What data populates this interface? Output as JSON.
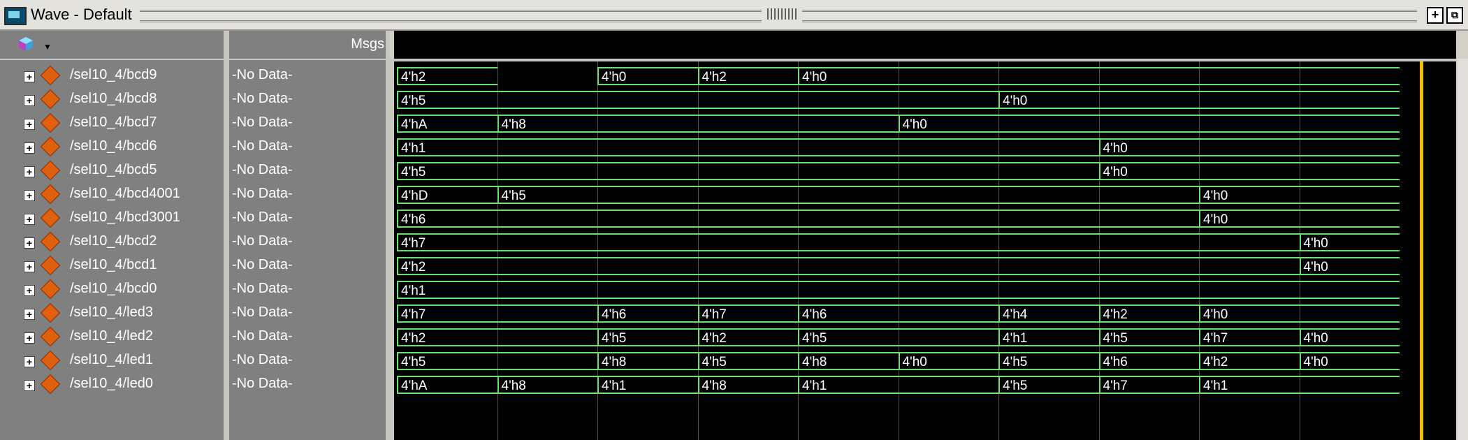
{
  "window": {
    "title": "Wave - Default"
  },
  "header": {
    "msgs_label": "Msgs"
  },
  "signals": [
    {
      "name": "/sel10_4/bcd9",
      "value": "-No Data-",
      "segments": [
        [
          "4'h2",
          0,
          1
        ],
        [
          "4'h0",
          2,
          3
        ],
        [
          "4'h2",
          3,
          4
        ],
        [
          "4'h0",
          4,
          10
        ]
      ]
    },
    {
      "name": "/sel10_4/bcd8",
      "value": "-No Data-",
      "segments": [
        [
          "4'h5",
          0,
          6
        ],
        [
          "4'h0",
          6,
          10
        ]
      ]
    },
    {
      "name": "/sel10_4/bcd7",
      "value": "-No Data-",
      "segments": [
        [
          "4'hA",
          0,
          1
        ],
        [
          "4'h8",
          1,
          5
        ],
        [
          "4'h0",
          5,
          10
        ]
      ]
    },
    {
      "name": "/sel10_4/bcd6",
      "value": "-No Data-",
      "segments": [
        [
          "4'h1",
          0,
          7
        ],
        [
          "4'h0",
          7,
          10
        ]
      ]
    },
    {
      "name": "/sel10_4/bcd5",
      "value": "-No Data-",
      "segments": [
        [
          "4'h5",
          0,
          7
        ],
        [
          "4'h0",
          7,
          10
        ]
      ]
    },
    {
      "name": "/sel10_4/bcd4001",
      "value": "-No Data-",
      "segments": [
        [
          "4'hD",
          0,
          1
        ],
        [
          "4'h5",
          1,
          8
        ],
        [
          "4'h0",
          8,
          10
        ]
      ]
    },
    {
      "name": "/sel10_4/bcd3001",
      "value": "-No Data-",
      "segments": [
        [
          "4'h6",
          0,
          8
        ],
        [
          "4'h0",
          8,
          10
        ]
      ]
    },
    {
      "name": "/sel10_4/bcd2",
      "value": "-No Data-",
      "segments": [
        [
          "4'h7",
          0,
          9
        ],
        [
          "4'h0",
          9,
          10
        ]
      ]
    },
    {
      "name": "/sel10_4/bcd1",
      "value": "-No Data-",
      "segments": [
        [
          "4'h2",
          0,
          9
        ],
        [
          "4'h0",
          9,
          10
        ]
      ]
    },
    {
      "name": "/sel10_4/bcd0",
      "value": "-No Data-",
      "segments": [
        [
          "4'h1",
          0,
          10
        ]
      ]
    },
    {
      "name": "/sel10_4/led3",
      "value": "-No Data-",
      "segments": [
        [
          "4'h7",
          0,
          2
        ],
        [
          "4'h6",
          2,
          3
        ],
        [
          "4'h7",
          3,
          4
        ],
        [
          "4'h6",
          4,
          6
        ],
        [
          "4'h4",
          6,
          7
        ],
        [
          "4'h2",
          7,
          8
        ],
        [
          "4'h0",
          8,
          10
        ]
      ]
    },
    {
      "name": "/sel10_4/led2",
      "value": "-No Data-",
      "segments": [
        [
          "4'h2",
          0,
          2
        ],
        [
          "4'h5",
          2,
          3
        ],
        [
          "4'h2",
          3,
          4
        ],
        [
          "4'h5",
          4,
          6
        ],
        [
          "4'h1",
          6,
          7
        ],
        [
          "4'h5",
          7,
          8
        ],
        [
          "4'h7",
          8,
          9
        ],
        [
          "4'h0",
          9,
          10
        ]
      ]
    },
    {
      "name": "/sel10_4/led1",
      "value": "-No Data-",
      "segments": [
        [
          "4'h5",
          0,
          2
        ],
        [
          "4'h8",
          2,
          3
        ],
        [
          "4'h5",
          3,
          4
        ],
        [
          "4'h8",
          4,
          5
        ],
        [
          "4'h0",
          5,
          6
        ],
        [
          "4'h5",
          6,
          7
        ],
        [
          "4'h6",
          7,
          8
        ],
        [
          "4'h2",
          8,
          9
        ],
        [
          "4'h0",
          9,
          10
        ]
      ]
    },
    {
      "name": "/sel10_4/led0",
      "value": "-No Data-",
      "segments": [
        [
          "4'hA",
          0,
          1
        ],
        [
          "4'h8",
          1,
          2
        ],
        [
          "4'h1",
          2,
          3
        ],
        [
          "4'h8",
          3,
          4
        ],
        [
          "4'h1",
          4,
          6
        ],
        [
          "4'h5",
          6,
          7
        ],
        [
          "4'h7",
          7,
          8
        ],
        [
          "4'h1",
          8,
          10
        ]
      ]
    }
  ],
  "icons": {
    "app": "wave-window-icon",
    "tool": "cube-icon",
    "dock": "dock-icon",
    "undock": "undock-icon"
  },
  "colors": {
    "wave": "#6ee06e",
    "cursor": "#f0c000",
    "background": "#000000"
  }
}
